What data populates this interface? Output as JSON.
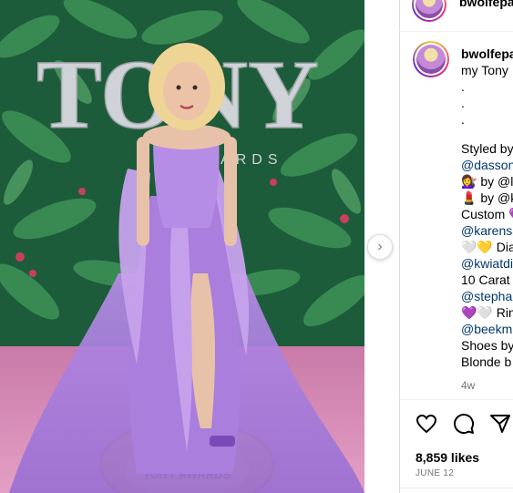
{
  "post": {
    "username": "bwolfepa",
    "caption_lines": [
      {
        "text": "my Tony",
        "kind": "plain"
      },
      {
        "text": ".",
        "kind": "plain"
      },
      {
        "text": ".",
        "kind": "plain"
      },
      {
        "text": ".",
        "kind": "plain"
      },
      {
        "text": "",
        "kind": "gap"
      },
      {
        "text": "Styled by",
        "kind": "plain"
      },
      {
        "text": "@dasson",
        "kind": "mention"
      },
      {
        "text": "💇‍♀️ by @l",
        "kind": "plain"
      },
      {
        "text": "💄 by @k",
        "kind": "plain"
      },
      {
        "text": "Custom 💜",
        "kind": "plain"
      },
      {
        "text": "@karensa",
        "kind": "mention"
      },
      {
        "text": "🤍💛 Dia",
        "kind": "plain"
      },
      {
        "text": "@kwiatdi",
        "kind": "mention"
      },
      {
        "text": "10 Carat",
        "kind": "plain"
      },
      {
        "text": "@stepha",
        "kind": "mention"
      },
      {
        "text": "💜🤍 Rin",
        "kind": "plain"
      },
      {
        "text": "@beekm",
        "kind": "mention"
      },
      {
        "text": "Shoes by",
        "kind": "plain"
      },
      {
        "text": "Blonde b",
        "kind": "plain"
      }
    ],
    "time_ago": "4w",
    "likes": "8,859 likes",
    "date": "JUNE 12",
    "photo_sign_text": "TONY",
    "photo_sign_sub": "AWARDS",
    "photo_floor_text": "TONY AWARDS"
  },
  "icons": {
    "like": "heart-icon",
    "comment": "comment-icon",
    "share": "paper-plane-icon",
    "next": "chevron-right-icon"
  },
  "colors": {
    "mention": "#00376b",
    "dress": "#a77ddb",
    "carpet": "#d98bb5",
    "leaves": "#2e7a4a"
  }
}
